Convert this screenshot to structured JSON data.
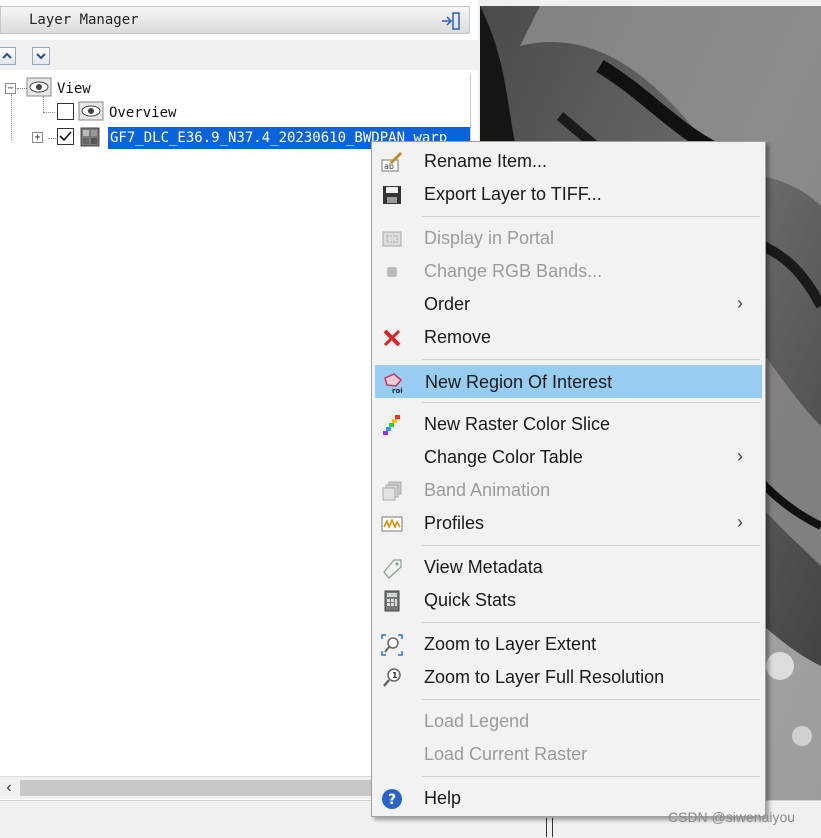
{
  "panel": {
    "title": "Layer Manager",
    "tree": {
      "root": "View",
      "children": [
        {
          "label": "Overview",
          "checked": false
        },
        {
          "label": "GF7_DLC_E36.9_N37.4_20230610_BWDPAN_warp",
          "checked": true,
          "selected": true
        }
      ]
    }
  },
  "context_menu": {
    "items": [
      {
        "label": "Rename Item...",
        "icon": "rename-icon"
      },
      {
        "label": "Export Layer to TIFF...",
        "icon": "floppy-disk-icon"
      },
      {
        "label": "Display in Portal",
        "icon": "portal-icon",
        "disabled": true
      },
      {
        "label": "Change RGB Bands...",
        "icon": "rgb-bands-icon",
        "disabled": true
      },
      {
        "label": "Order",
        "submenu": true
      },
      {
        "label": "Remove",
        "icon": "red-x-icon"
      },
      {
        "label": "New Region Of Interest",
        "icon": "roi-icon",
        "highlighted": true
      },
      {
        "label": "New Raster Color Slice",
        "icon": "color-slice-icon"
      },
      {
        "label": "Change Color Table",
        "submenu": true
      },
      {
        "label": "Band Animation",
        "icon": "band-animation-icon",
        "disabled": true
      },
      {
        "label": "Profiles",
        "icon": "profiles-icon",
        "submenu": true
      },
      {
        "label": "View Metadata",
        "icon": "tag-icon"
      },
      {
        "label": "Quick Stats",
        "icon": "calculator-icon"
      },
      {
        "label": "Zoom to Layer Extent",
        "icon": "zoom-extent-icon"
      },
      {
        "label": "Zoom to Layer Full Resolution",
        "icon": "zoom-full-resolution-icon"
      },
      {
        "label": "Load Legend",
        "disabled": true
      },
      {
        "label": "Load Current Raster",
        "disabled": true
      },
      {
        "label": "Help",
        "icon": "help-icon"
      }
    ]
  },
  "watermark": "CSDN @siwenaiyou",
  "colors": {
    "selection": "#0a63d8",
    "menu_highlight": "#99ccf1",
    "menu_bg": "#f2f2f2"
  }
}
